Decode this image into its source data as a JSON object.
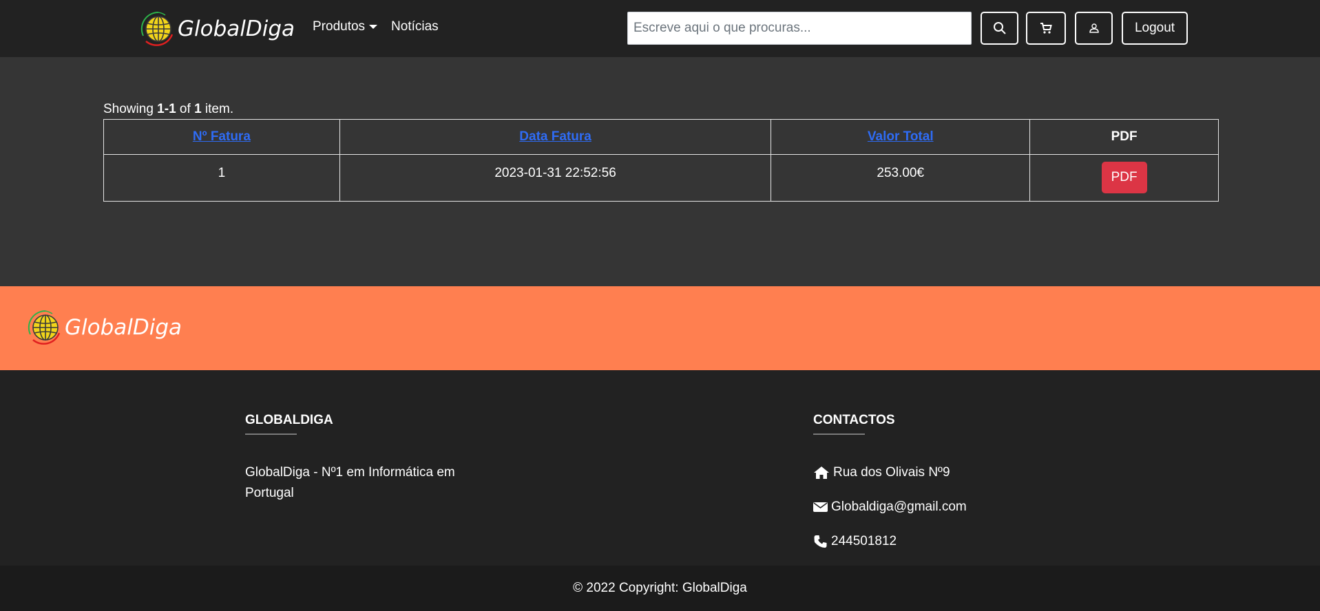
{
  "brand": {
    "name": "GlobalDiga"
  },
  "nav": {
    "products_label": "Produtos",
    "news_label": "Notícias",
    "search_placeholder": "Escreve aqui o que procuras...",
    "logout_label": "Logout"
  },
  "summary": {
    "prefix": "Showing",
    "range": "1-1",
    "of": "of",
    "total": "1",
    "suffix": "item."
  },
  "table": {
    "headers": [
      "Nº Fatura",
      "Data Fatura",
      "Valor Total",
      "PDF"
    ],
    "rows": [
      {
        "invoice_no": "1",
        "date": "2023-01-31 22:52:56",
        "total": "253.00€",
        "pdf_label": "PDF"
      }
    ]
  },
  "footer": {
    "about_title": "GLOBALDIGA",
    "about_text": "GlobalDiga - Nº1 em Informática em Portugal",
    "contacts_title": "CONTACTOS",
    "address": "Rua dos Olivais Nº9",
    "email": "Globaldiga@gmail.com",
    "phone": "244501812",
    "copyright": "© 2022 Copyright: GlobalDiga"
  },
  "colors": {
    "navbar_bg": "#222222",
    "page_bg": "#353535",
    "band_bg": "#ff7f50",
    "link": "#2f6cf5",
    "pdf_button": "#dc3545"
  },
  "icons": [
    "globe-logo-icon",
    "search-icon",
    "cart-icon",
    "user-icon",
    "home-icon",
    "envelope-icon",
    "phone-icon",
    "caret-down-icon"
  ]
}
